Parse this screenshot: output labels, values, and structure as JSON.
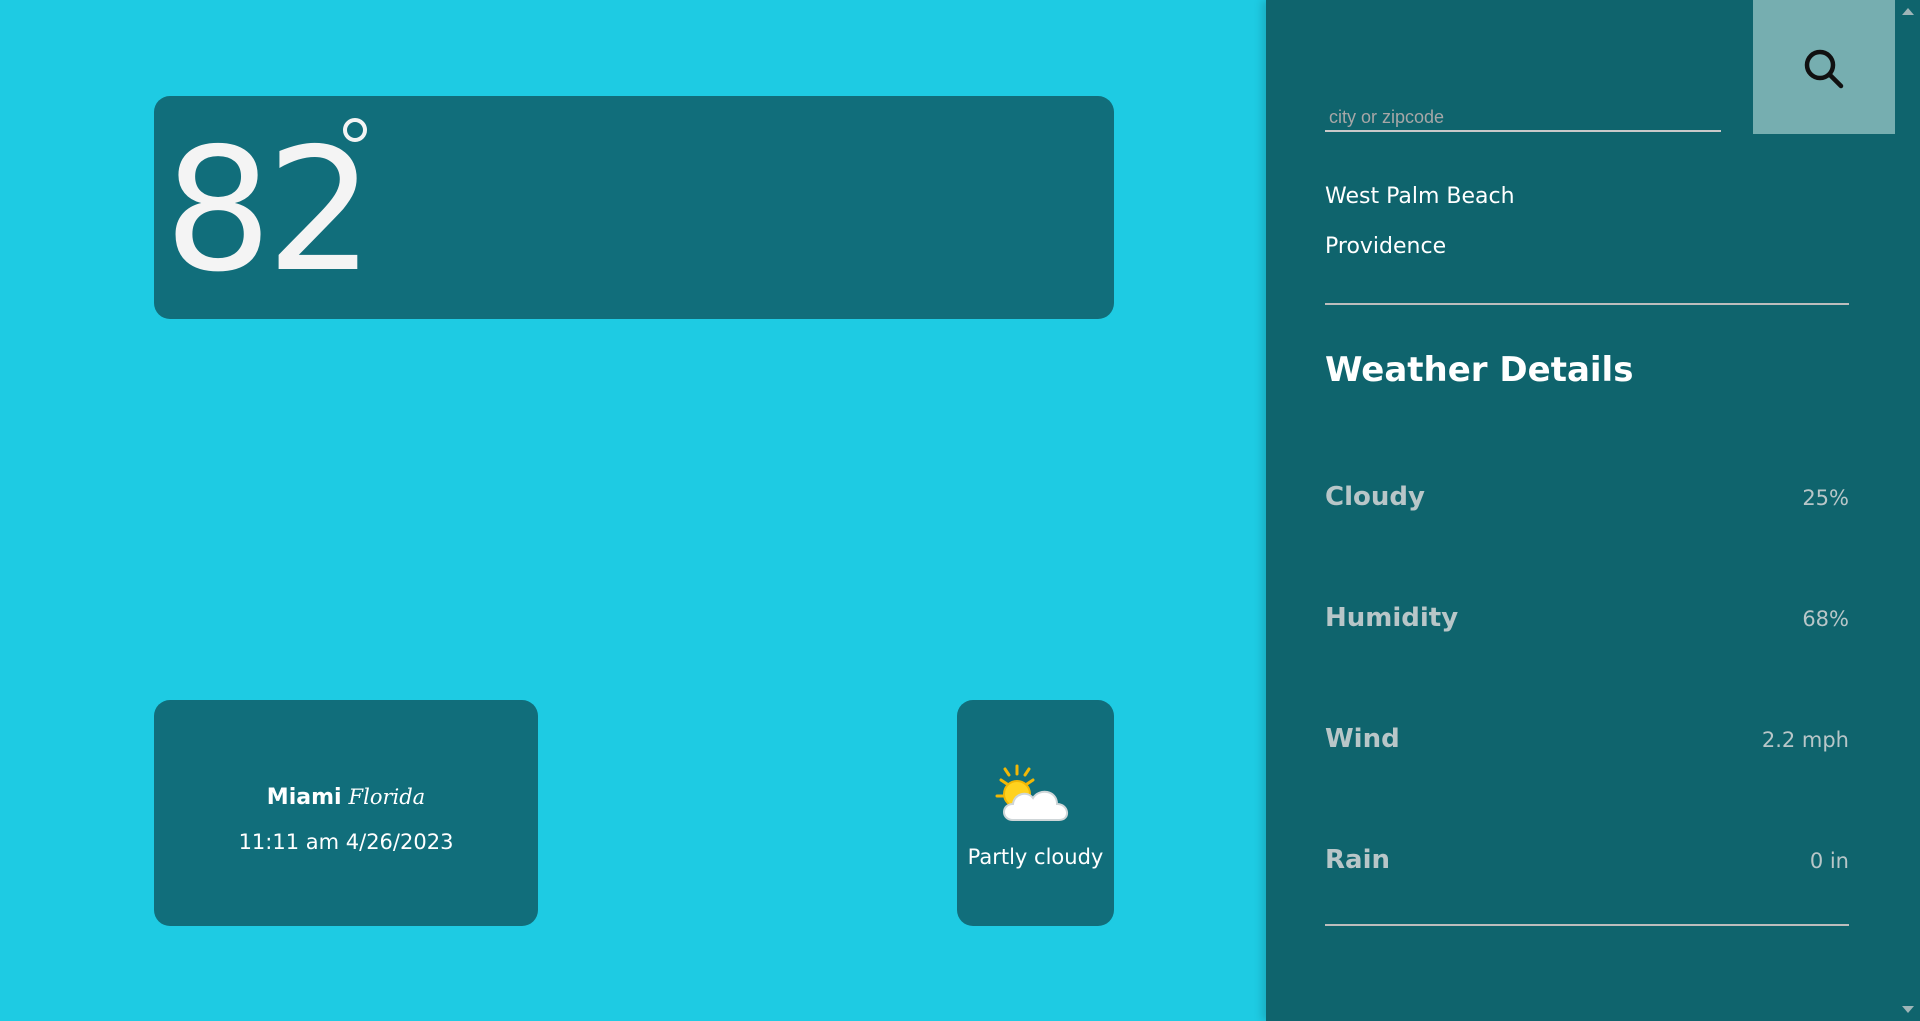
{
  "current": {
    "temperature": "82"
  },
  "location": {
    "city": "Miami",
    "state": "Florida",
    "datetime": "11:11 am 4/26/2023"
  },
  "condition": {
    "icon": "partly-cloudy-icon",
    "text": "Partly cloudy"
  },
  "search": {
    "placeholder": "city or zipcode",
    "value": "",
    "button_icon": "search-icon"
  },
  "recent_locations": [
    {
      "label": "West Palm Beach"
    },
    {
      "label": "Providence"
    }
  ],
  "details": {
    "title": "Weather Details",
    "rows": [
      {
        "label": "Cloudy",
        "value": "25%"
      },
      {
        "label": "Humidity",
        "value": "68%"
      },
      {
        "label": "Wind",
        "value": "2.2 mph"
      },
      {
        "label": "Rain",
        "value": "0 in"
      }
    ]
  },
  "colors": {
    "background": "#1ecbe3",
    "card": "#116e7b",
    "sidebar": "#0f646d",
    "search_button": "#76aeb0",
    "muted_text": "#b8c6c8"
  }
}
